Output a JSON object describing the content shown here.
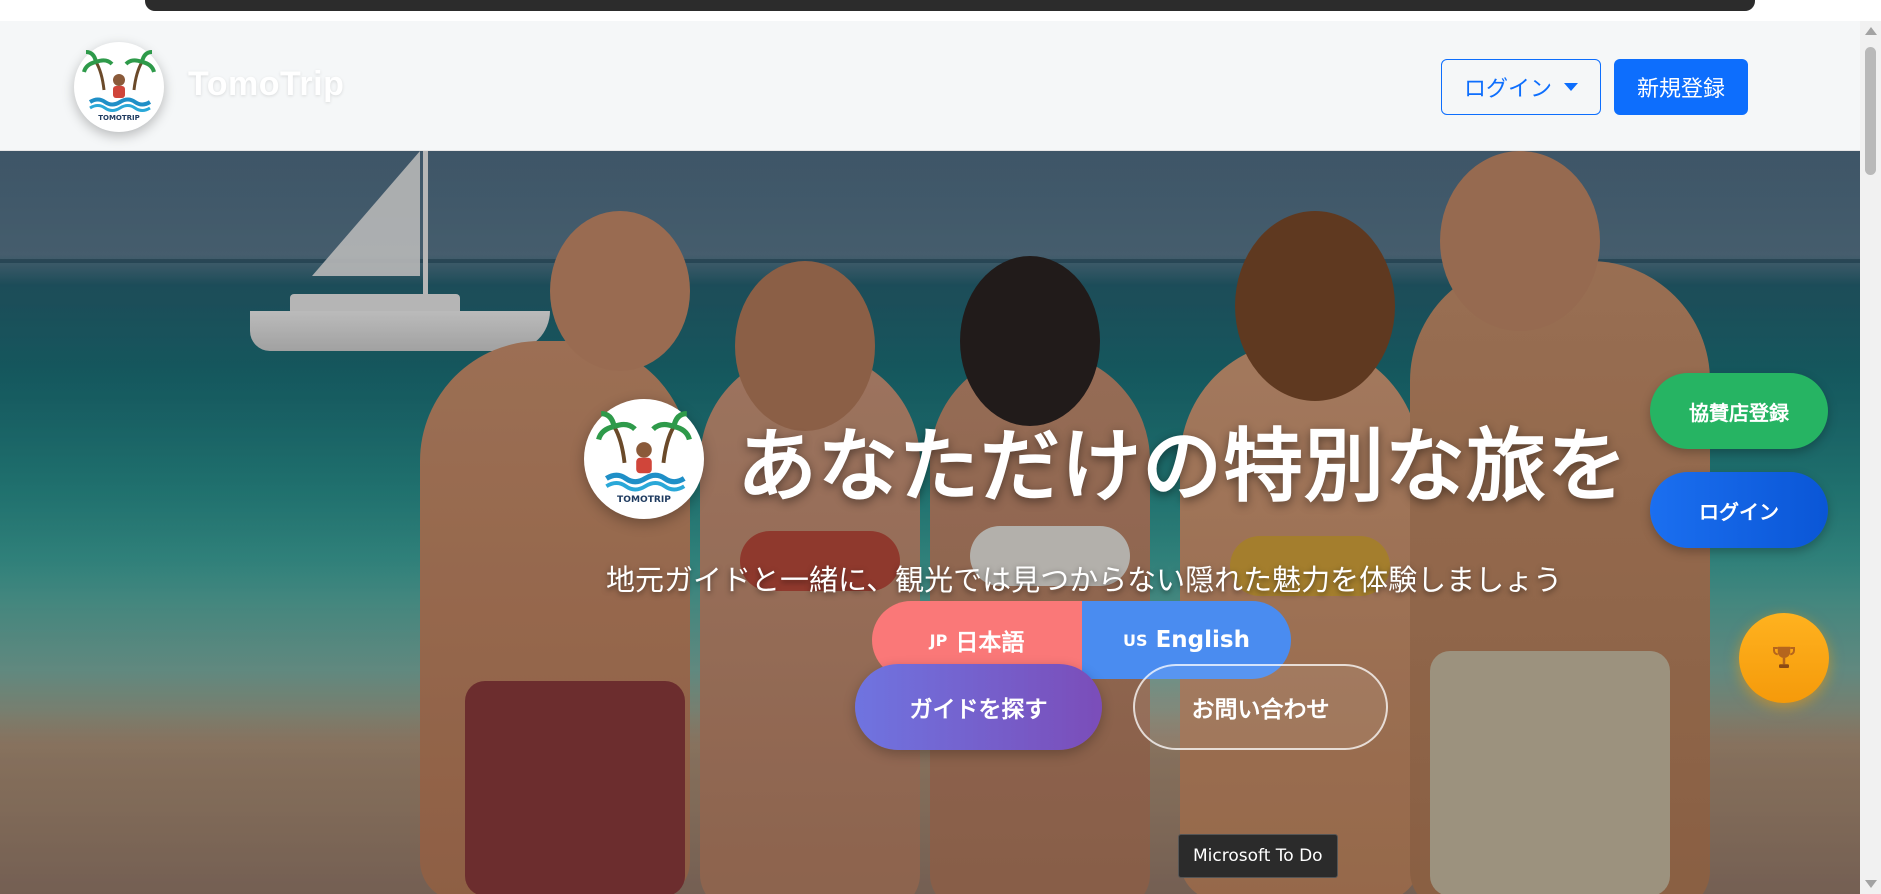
{
  "header": {
    "brand": "TomoTrip",
    "logo_text": "TOMOTRIP",
    "login_label": "ログイン",
    "signup_label": "新規登録"
  },
  "hero": {
    "title": "あなただけの特別な旅を",
    "subtitle": "地元ガイドと一緒に、観光では見つからない隠れた魅力を体験しましょう",
    "lang_jp_code": "JP",
    "lang_jp_label": "日本語",
    "lang_en_code": "US",
    "lang_en_label": "English",
    "find_guide_label": "ガイドを探す",
    "contact_label": "お問い合わせ"
  },
  "side": {
    "sponsor_label": "協賛店登録",
    "login_label": "ログイン",
    "trophy_icon": "trophy-icon"
  },
  "tooltip": {
    "text": "Microsoft To Do"
  },
  "colors": {
    "primary": "#0d6efd",
    "sponsor_green": "#26b463",
    "trophy_orange": "#ffb21f",
    "jp_red": "#fa7878",
    "en_blue": "#4a8cf0",
    "find_purple": "#7b4db9"
  }
}
